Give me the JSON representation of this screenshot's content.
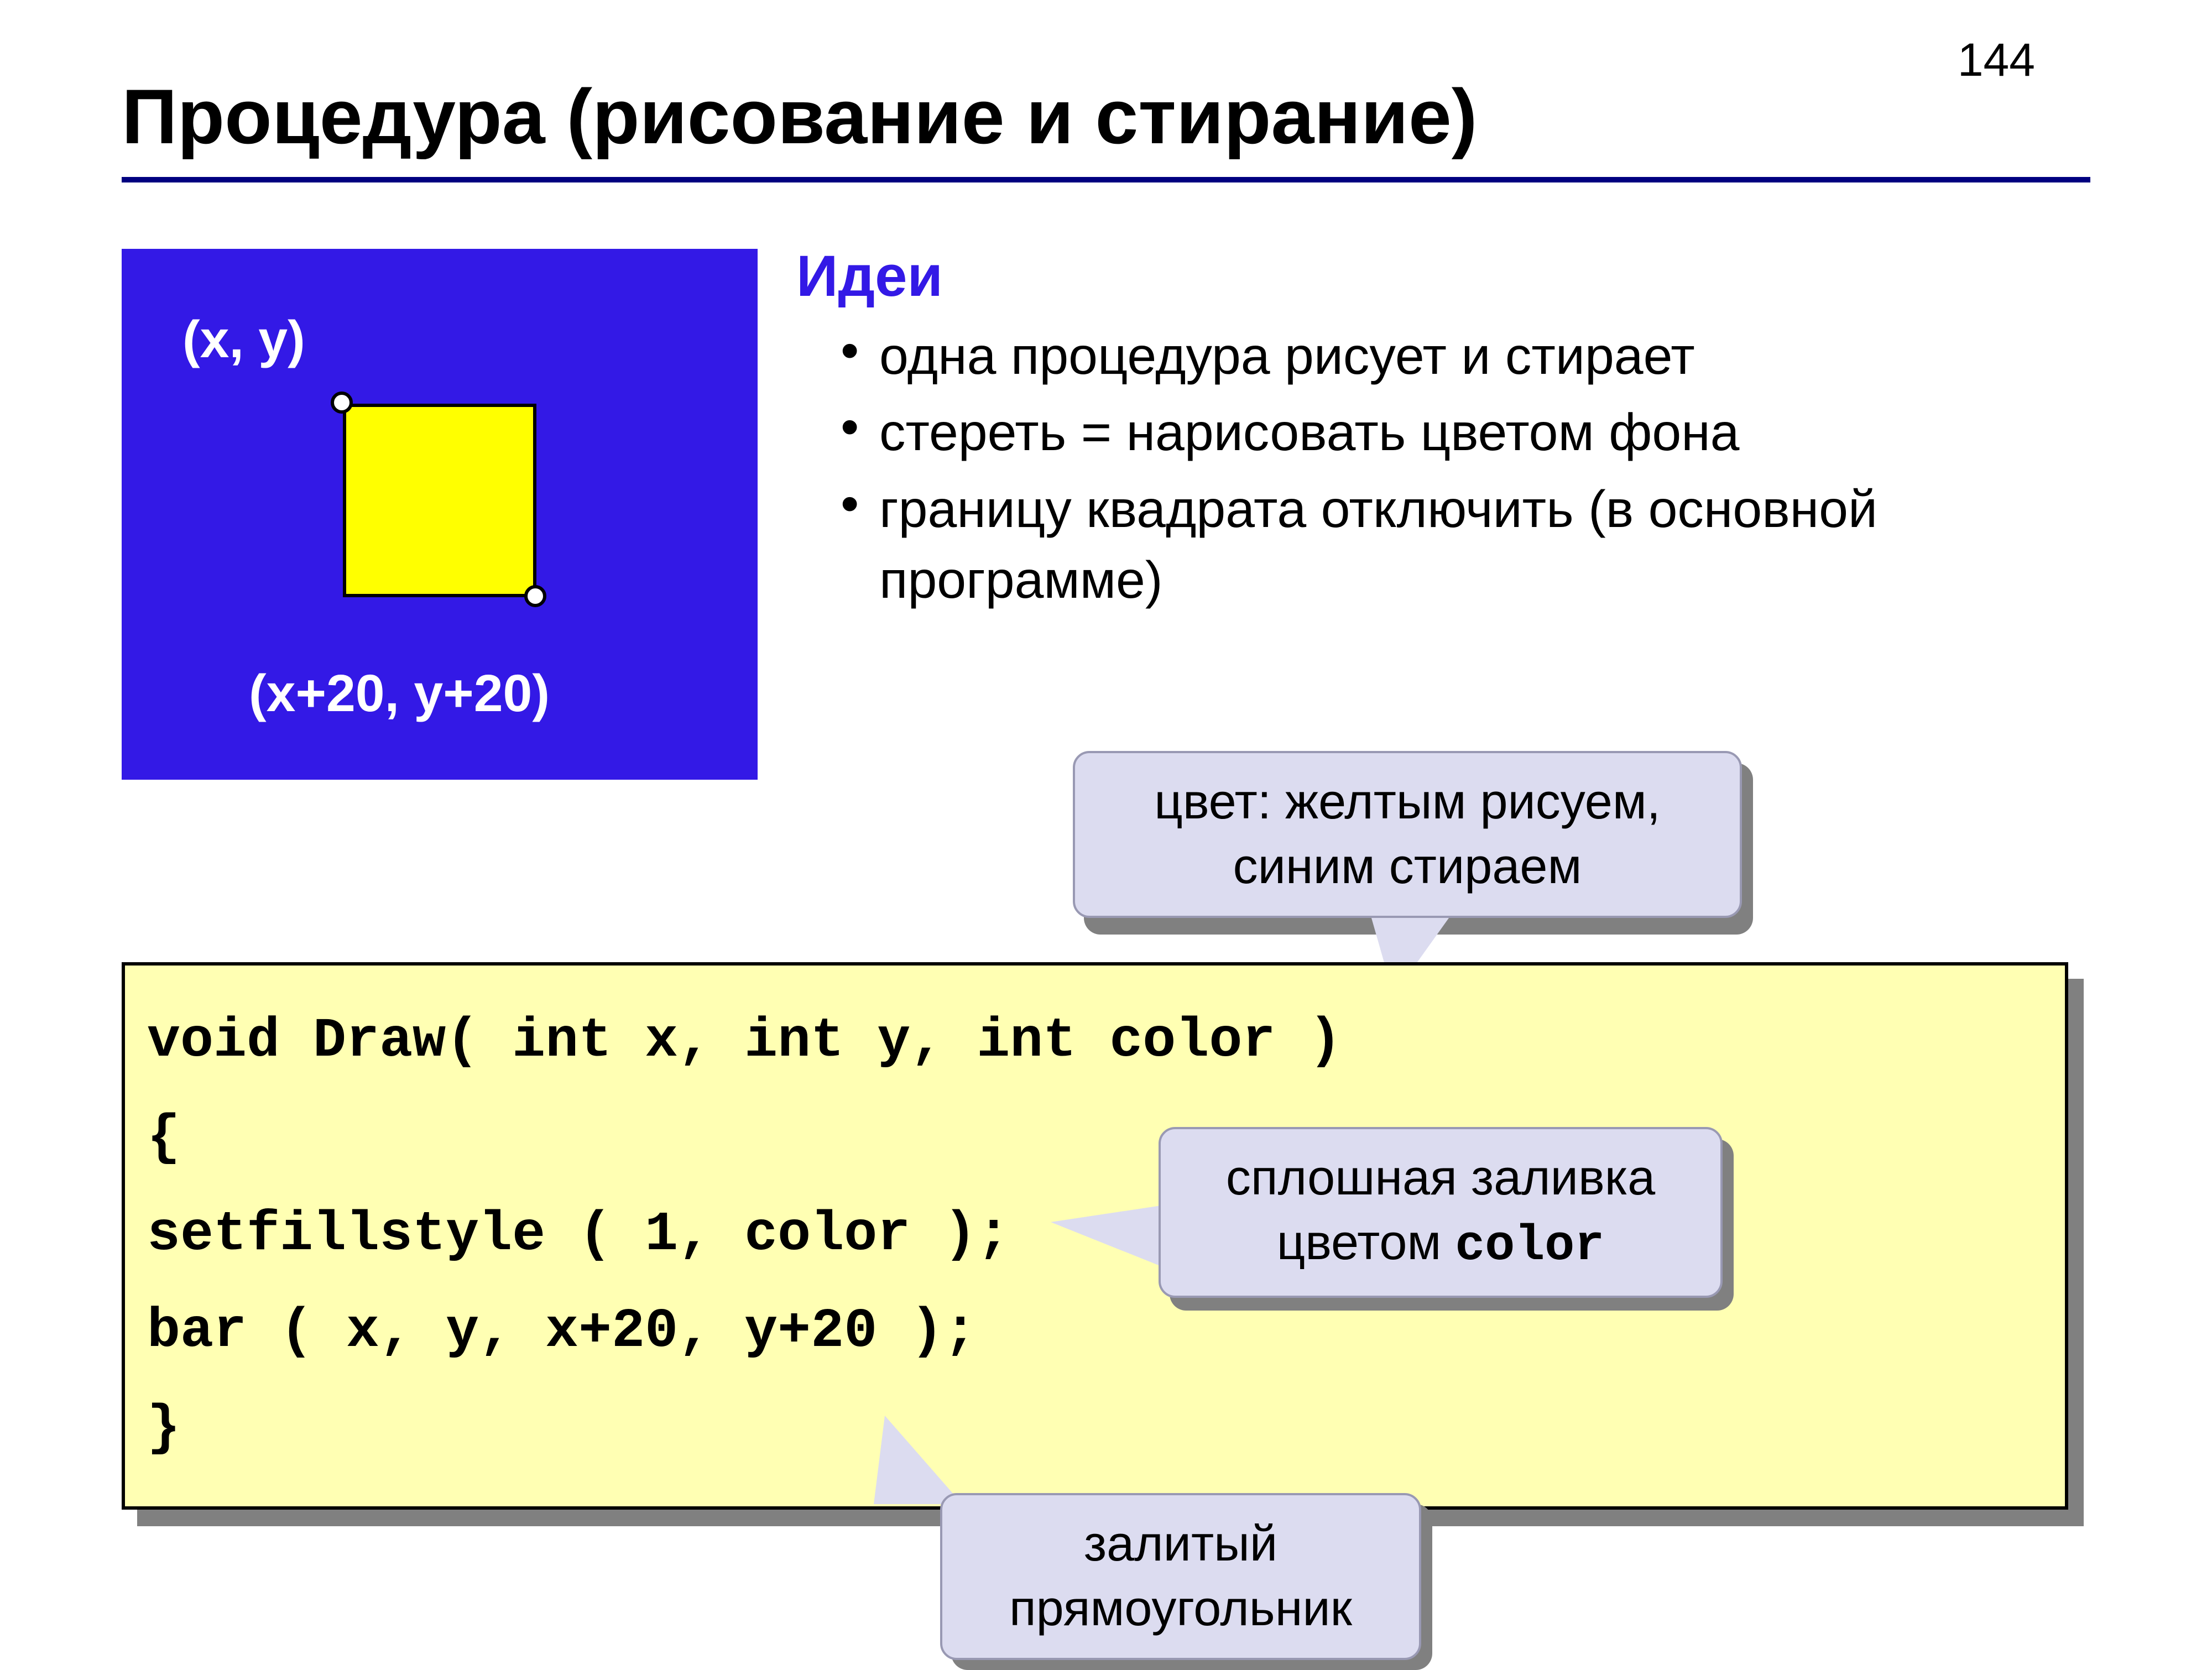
{
  "page_number": "144",
  "title": "Процедура (рисование и стирание)",
  "diagram": {
    "top_label": "(x, y)",
    "bottom_label": "(x+20, y+20)"
  },
  "ideas": {
    "heading": "Идеи",
    "items": [
      "одна процедура рисует и стирает",
      "стереть = нарисовать цветом фона",
      "границу квадрата отключить (в основной программе)"
    ]
  },
  "code": {
    "l1": "void Draw( int x, int y, int color )",
    "l2": "{",
    "l3": "setfillstyle ( 1, color );",
    "l4": "bar ( x, y, x+20, y+20 );",
    "l5": "}"
  },
  "callouts": {
    "c1": "цвет: желтым рисуем, синим стираем",
    "c2_pre": "сплошная заливка цветом ",
    "c2_code": "color",
    "c3": "залитый прямоугольник"
  }
}
